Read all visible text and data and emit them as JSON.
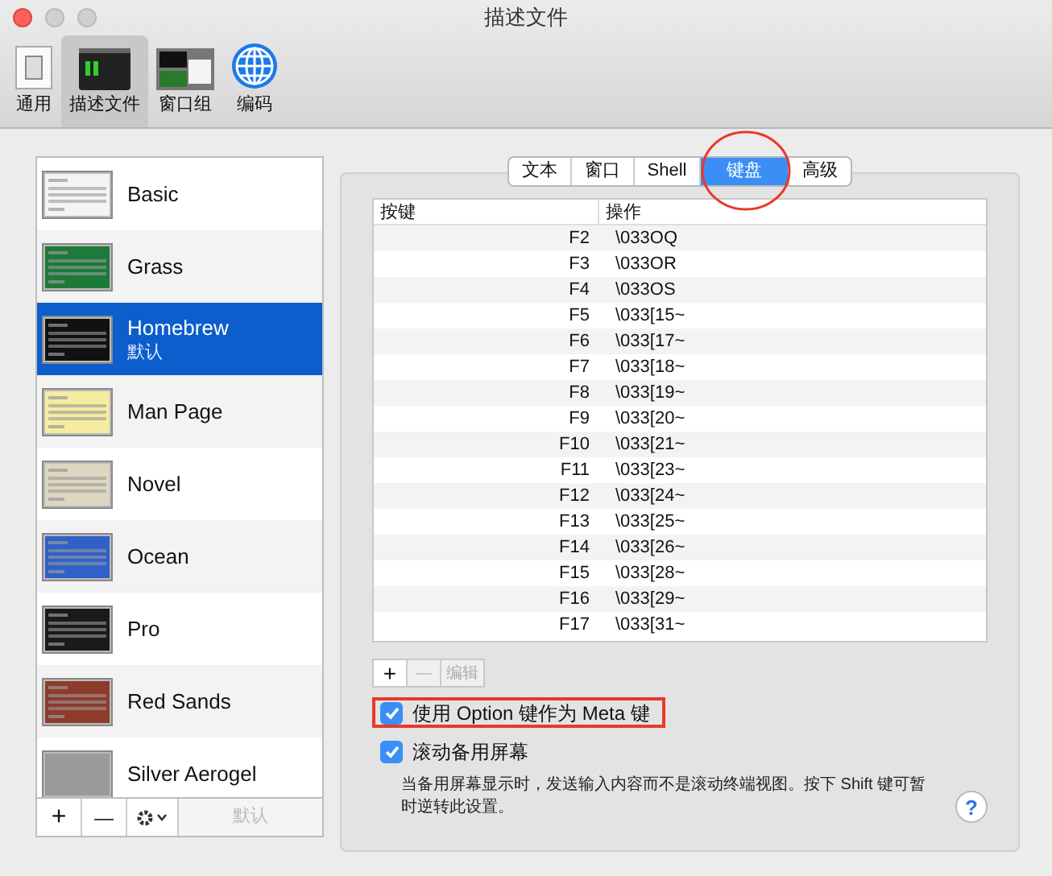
{
  "window": {
    "title": "描述文件"
  },
  "toolbar": [
    {
      "label": "通用",
      "kind": "general",
      "selected": false
    },
    {
      "label": "描述文件",
      "kind": "profiles",
      "selected": true
    },
    {
      "label": "窗口组",
      "kind": "groups",
      "selected": false
    },
    {
      "label": "编码",
      "kind": "encoding",
      "selected": false
    }
  ],
  "profiles": [
    {
      "name": "Basic",
      "color": "#f4f4f4",
      "selected": false
    },
    {
      "name": "Grass",
      "color": "#1d7a3a",
      "selected": false
    },
    {
      "name": "Homebrew",
      "subtitle": "默认",
      "color": "#111111",
      "selected": true
    },
    {
      "name": "Man Page",
      "color": "#f5eca0",
      "selected": false
    },
    {
      "name": "Novel",
      "color": "#ddd6c0",
      "selected": false
    },
    {
      "name": "Ocean",
      "color": "#2f61c9",
      "selected": false
    },
    {
      "name": "Pro",
      "color": "#1a1a1a",
      "selected": false
    },
    {
      "name": "Red Sands",
      "color": "#8e3b2c",
      "selected": false
    },
    {
      "name": "Silver Aerogel",
      "color": "#9a9a9a",
      "selected": false
    }
  ],
  "profile_buttons": {
    "add": "+",
    "remove": "—",
    "default": "默认"
  },
  "tabs": [
    {
      "label": "文本",
      "selected": false
    },
    {
      "label": "窗口",
      "selected": false
    },
    {
      "label": "Shell",
      "selected": false
    },
    {
      "label": "键盘",
      "selected": true
    },
    {
      "label": "高级",
      "selected": false
    }
  ],
  "table": {
    "columns": [
      "按键",
      "操作"
    ],
    "rows": [
      [
        "F2",
        "\\033OQ"
      ],
      [
        "F3",
        "\\033OR"
      ],
      [
        "F4",
        "\\033OS"
      ],
      [
        "F5",
        "\\033[15~"
      ],
      [
        "F6",
        "\\033[17~"
      ],
      [
        "F7",
        "\\033[18~"
      ],
      [
        "F8",
        "\\033[19~"
      ],
      [
        "F9",
        "\\033[20~"
      ],
      [
        "F10",
        "\\033[21~"
      ],
      [
        "F11",
        "\\033[23~"
      ],
      [
        "F12",
        "\\033[24~"
      ],
      [
        "F13",
        "\\033[25~"
      ],
      [
        "F14",
        "\\033[26~"
      ],
      [
        "F15",
        "\\033[28~"
      ],
      [
        "F16",
        "\\033[29~"
      ],
      [
        "F17",
        "\\033[31~"
      ]
    ]
  },
  "table_buttons": {
    "add": "+",
    "remove": "—",
    "edit": "编辑"
  },
  "options": [
    {
      "label": "使用 Option 键作为 Meta 键",
      "checked": true,
      "highlighted": true
    },
    {
      "label": "滚动备用屏幕",
      "checked": true,
      "highlighted": false
    }
  ],
  "note": "当备用屏幕显示时，发送输入内容而不是滚动终端视图。按下 Shift 键可暂时逆转此设置。",
  "help": "?"
}
